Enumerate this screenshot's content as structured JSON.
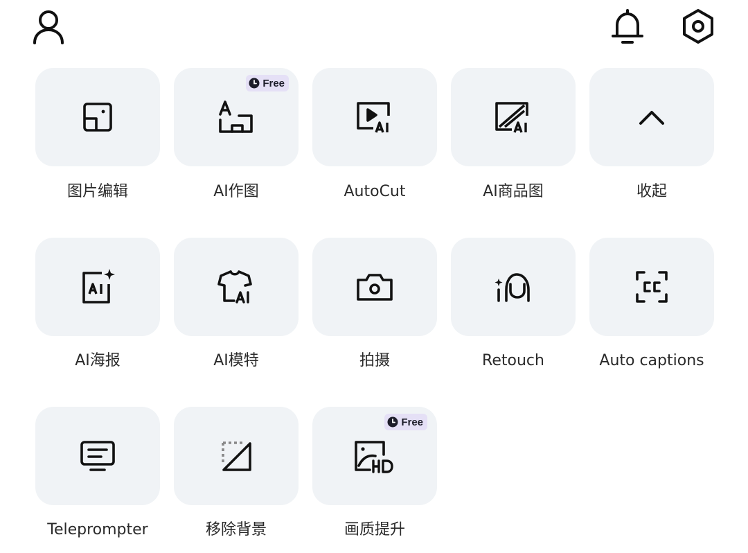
{
  "header": {
    "profile_icon": "user-icon",
    "notification_icon": "bell-icon",
    "settings_icon": "hexagon-settings-icon"
  },
  "badge": {
    "free_label": "Free"
  },
  "tools": [
    {
      "label": "图片编辑",
      "icon": "photo-edit-icon"
    },
    {
      "label": "AI作图",
      "icon": "ai-drawing-icon",
      "badge": "Free"
    },
    {
      "label": "AutoCut",
      "icon": "autocut-icon"
    },
    {
      "label": "AI商品图",
      "icon": "ai-product-image-icon"
    },
    {
      "label": "收起",
      "icon": "chevron-up-icon"
    },
    {
      "label": "AI海报",
      "icon": "ai-poster-icon"
    },
    {
      "label": "AI模特",
      "icon": "ai-model-shirt-icon"
    },
    {
      "label": "拍摄",
      "icon": "camera-icon"
    },
    {
      "label": "Retouch",
      "icon": "retouch-icon"
    },
    {
      "label": "Auto captions",
      "icon": "captions-icon"
    },
    {
      "label": "Teleprompter",
      "icon": "teleprompter-icon"
    },
    {
      "label": "移除背景",
      "icon": "remove-background-icon"
    },
    {
      "label": "画质提升",
      "icon": "hd-enhance-icon",
      "badge": "Free"
    }
  ]
}
